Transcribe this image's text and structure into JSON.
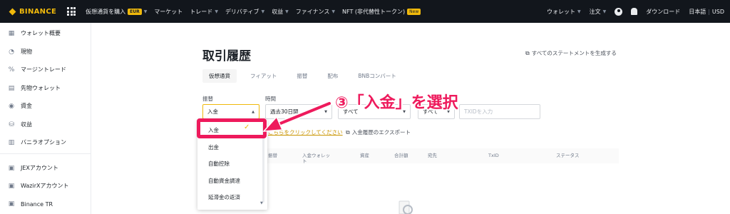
{
  "topbar": {
    "logo": "BINANCE",
    "nav": [
      {
        "label": "仮想通貨を購入",
        "badge": "EUR"
      },
      {
        "label": "マーケット"
      },
      {
        "label": "トレード"
      },
      {
        "label": "デリバティブ"
      },
      {
        "label": "収益"
      },
      {
        "label": "ファイナンス"
      },
      {
        "label": "NFT (非代替性トークン)",
        "badge": "New"
      }
    ],
    "right": {
      "wallet": "ウォレット",
      "orders": "注文",
      "download": "ダウンロード",
      "language": "日本語",
      "currency": "USD"
    }
  },
  "sidebar": {
    "items": [
      {
        "label": "ウォレット概要",
        "icon": "wallet-grid-icon"
      },
      {
        "label": "現物",
        "icon": "spot-icon"
      },
      {
        "label": "マージントレード",
        "icon": "margin-icon"
      },
      {
        "label": "先物ウォレット",
        "icon": "futures-icon"
      },
      {
        "label": "資金",
        "icon": "funding-icon"
      },
      {
        "label": "収益",
        "icon": "earn-icon"
      },
      {
        "label": "バニラオプション",
        "icon": "options-icon"
      },
      {
        "label": "JEXアカウント",
        "icon": "jex-icon"
      },
      {
        "label": "WazirXアカウント",
        "icon": "wazirx-icon"
      },
      {
        "label": "Binance TR",
        "icon": "binance-tr-icon"
      }
    ]
  },
  "main": {
    "title": "取引履歴",
    "generate_statement": "すべてのステートメントを生成する",
    "tabs": [
      "仮想通貨",
      "フィアット",
      "振替",
      "配布",
      "BNBコンバート"
    ],
    "filters": {
      "type_label": "振替",
      "type_value": "入金",
      "time_label": "時間",
      "time_value": "過去30日間",
      "asset_value": "すべて",
      "status_value": "すべて",
      "txid_placeholder": "TXIDを入力"
    },
    "notice_link": "こちらをクリックしてください",
    "export": "入金履歴のエクスポート",
    "table_headers": [
      "振替",
      "入金ウォレット",
      "資産",
      "合計額",
      "宛先",
      "TxID",
      "ステータス"
    ]
  },
  "dropdown": {
    "options": [
      "入金",
      "出金",
      "自動控除",
      "自動資金調達",
      "延滞金の返済"
    ],
    "selected": "入金"
  },
  "annotation": {
    "text": "③「入金」を選択",
    "color": "#ee1a5c"
  },
  "colors": {
    "brand": "#f0b90b",
    "topbar_bg": "#12161c",
    "annotation": "#ee1a5c"
  }
}
